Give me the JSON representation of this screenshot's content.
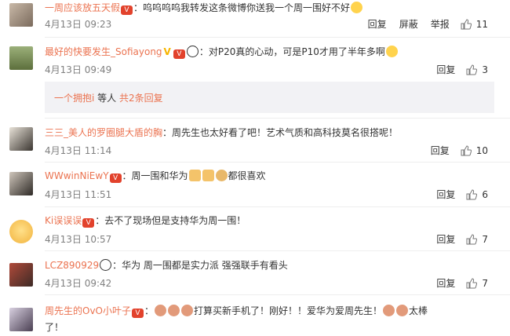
{
  "comments": [
    {
      "username": "一周应该放五天假",
      "text": "：呜呜呜呜我转发这条微博你送我一个周一围好不好",
      "date": "4月13日 09:23",
      "actions": [
        "回复",
        "屏蔽",
        "举报"
      ],
      "likes": "11"
    },
    {
      "username": "最好的快要发生_Sofiayong",
      "text": "：对P20真的心动，可是P10才用了半年多啊",
      "date": "4月13日 09:49",
      "actions": [
        "回复"
      ],
      "likes": "3"
    },
    {
      "username": "三三_美人的罗圈腿大盾的胸",
      "text": "：周先生也太好看了吧！艺术气质和高科技莫名很搭呢！",
      "date": "4月13日 11:14",
      "actions": [
        "回复"
      ],
      "likes": "10"
    },
    {
      "username": "WWwinNiEwY",
      "text": "：周一围和华为",
      "text2": "都很喜欢",
      "date": "4月13日 11:51",
      "actions": [
        "回复"
      ],
      "likes": "6"
    },
    {
      "username": "Ki误误误",
      "text": "：去不了现场但是支持华为周一围！",
      "date": "4月13日 10:57",
      "actions": [
        "回复"
      ],
      "likes": "7"
    },
    {
      "username": "LCZ890929",
      "text": "：华为  周一围都是实力派  强强联手有看头",
      "date": "4月13日 09:42",
      "actions": [
        "回复"
      ],
      "likes": "7"
    },
    {
      "username": "周先生的OvO小叶子",
      "text": "：",
      "text2": "打算买新手机了！刚好！！爱华为爱周先生！",
      "text3": "太棒",
      "text4": "了！"
    }
  ],
  "sub_replies": {
    "user": "一个拥抱i",
    "middle": " 等人 ",
    "count": "共2条回复"
  },
  "icons": {
    "vip_badge": "vip-badge-icon",
    "verified": "verified-v-icon",
    "panda": "panda-emoji-icon",
    "crying": "crying-emoji-icon",
    "grin": "grin-emoji-icon",
    "thumbs": "thumbs-up-emoji-icon",
    "cake": "cake-emoji-icon",
    "like": "thumb-up-icon"
  },
  "colors": {
    "username": "#eb7350",
    "meta": "#808080",
    "vip": "#f7b500",
    "subbox": "#f2f2f5"
  }
}
